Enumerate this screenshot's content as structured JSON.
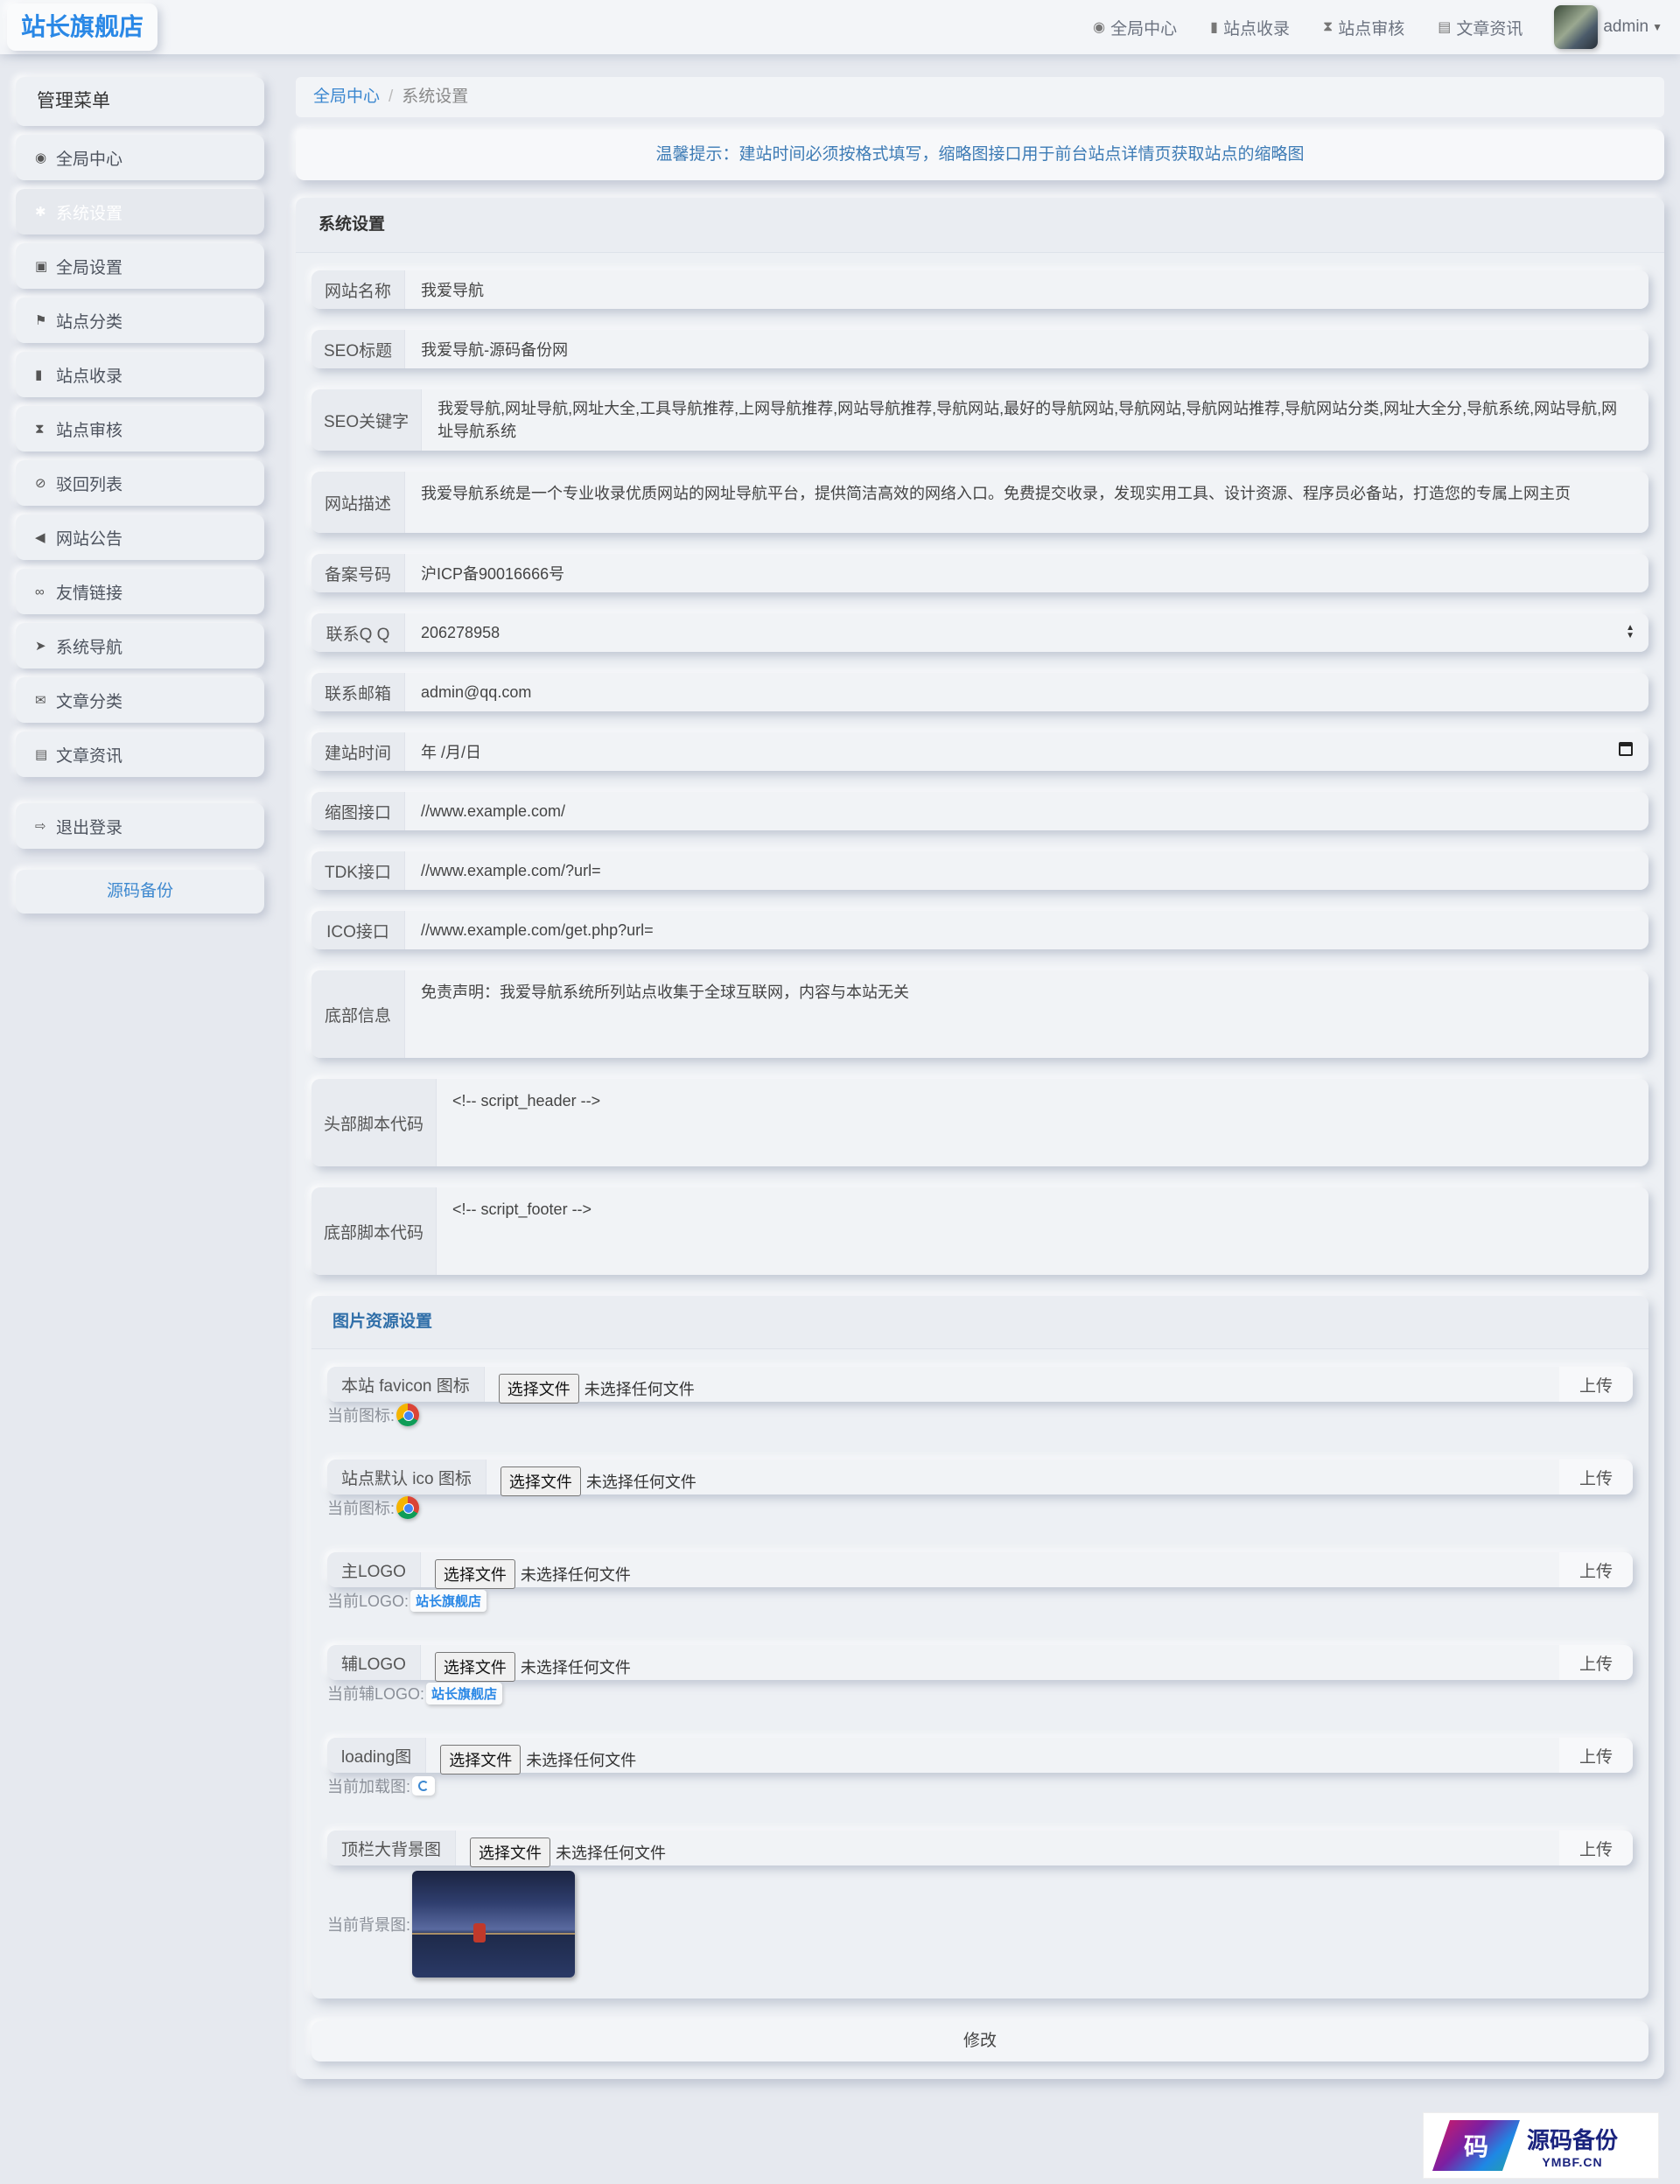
{
  "brand": "站长旗舰店",
  "topnav": [
    {
      "icon": "dashboard-icon",
      "glyph": "◉",
      "label": "全局中心"
    },
    {
      "icon": "book-icon",
      "glyph": "▮",
      "label": "站点收录"
    },
    {
      "icon": "hourglass-icon",
      "glyph": "⧗",
      "label": "站点审核"
    },
    {
      "icon": "newspaper-icon",
      "glyph": "▤",
      "label": "文章资讯"
    }
  ],
  "user": {
    "name": "admin"
  },
  "sidebar": {
    "title": "管理菜单",
    "items": [
      {
        "label": "全局中心",
        "glyph": "◉"
      },
      {
        "label": "系统设置",
        "glyph": "✱"
      },
      {
        "label": "全局设置",
        "glyph": "▣"
      },
      {
        "label": "站点分类",
        "glyph": "⚑"
      },
      {
        "label": "站点收录",
        "glyph": "▮"
      },
      {
        "label": "站点审核",
        "glyph": "⧗"
      },
      {
        "label": "驳回列表",
        "glyph": "⊘"
      },
      {
        "label": "网站公告",
        "glyph": "◀"
      },
      {
        "label": "友情链接",
        "glyph": "∞"
      },
      {
        "label": "系统导航",
        "glyph": "➤"
      },
      {
        "label": "文章分类",
        "glyph": "✉"
      },
      {
        "label": "文章资讯",
        "glyph": "▤"
      }
    ],
    "logout": {
      "label": "退出登录",
      "glyph": "⇨"
    },
    "source_button": "源码备份"
  },
  "breadcrumb": {
    "home": "全局中心",
    "separator": "/",
    "current": "系统设置"
  },
  "notice": "温馨提示：建站时间必须按格式填写，缩略图接口用于前台站点详情页获取站点的缩略图",
  "panel_title": "系统设置",
  "fields": {
    "site_name": {
      "label": "网站名称",
      "value": "我爱导航"
    },
    "seo_title": {
      "label": "SEO标题",
      "value": "我爱导航-源码备份网"
    },
    "seo_keywords": {
      "label": "SEO关键字",
      "value": "我爱导航,网址导航,网址大全,工具导航推荐,上网导航推荐,网站导航推荐,导航网站,最好的导航网站,导航网站,导航网站推荐,导航网站分类,网址大全分,导航系统,网站导航,网址导航系统"
    },
    "site_desc": {
      "label": "网站描述",
      "value": "我爱导航系统是一个专业收录优质网站的网址导航平台，提供简洁高效的网络入口。免费提交收录，发现实用工具、设计资源、程序员必备站，打造您的专属上网主页"
    },
    "icp": {
      "label": "备案号码",
      "value": "沪ICP备90016666号"
    },
    "qq": {
      "label": "联系Q Q",
      "value": "206278958"
    },
    "email": {
      "label": "联系邮箱",
      "value": "admin@qq.com"
    },
    "build_date": {
      "label": "建站时间",
      "value": "年 /月/日"
    },
    "thumb_api": {
      "label": "缩图接口",
      "value": "//www.example.com/"
    },
    "tdk_api": {
      "label": "TDK接口",
      "value": "//www.example.com/?url="
    },
    "ico_api": {
      "label": "ICO接口",
      "value": "//www.example.com/get.php?url="
    },
    "footer_info": {
      "label": "底部信息",
      "value": "免责声明：我爱导航系统所列站点收集于全球互联网，内容与本站无关"
    },
    "header_script": {
      "label": "头部脚本代码",
      "value": "<!-- script_header -->"
    },
    "footer_script": {
      "label": "底部脚本代码",
      "value": "<!-- script_footer -->"
    }
  },
  "image_section": {
    "title": "图片资源设置",
    "choose_label": "选择文件",
    "no_file": "未选择任何文件",
    "upload_label": "上传",
    "uploads": [
      {
        "label": "本站 favicon 图标",
        "current_label": "当前图标:",
        "preview": "chrome-icon"
      },
      {
        "label": "站点默认 ico 图标",
        "current_label": "当前图标:",
        "preview": "chrome-icon"
      },
      {
        "label": "主LOGO",
        "current_label": "当前LOGO:",
        "preview_text": "站长旗舰店"
      },
      {
        "label": "辅LOGO",
        "current_label": "当前辅LOGO:",
        "preview_text": "站长旗舰店"
      },
      {
        "label": "loading图",
        "current_label": "当前加载图:",
        "preview": "loading-icon"
      },
      {
        "label": "顶栏大背景图",
        "current_label": "当前背景图:",
        "preview": "background-thumbnail"
      }
    ]
  },
  "submit_label": "修改",
  "watermark": {
    "logo_char": "码",
    "name": "源码备份",
    "domain": "YMBF.CN"
  }
}
